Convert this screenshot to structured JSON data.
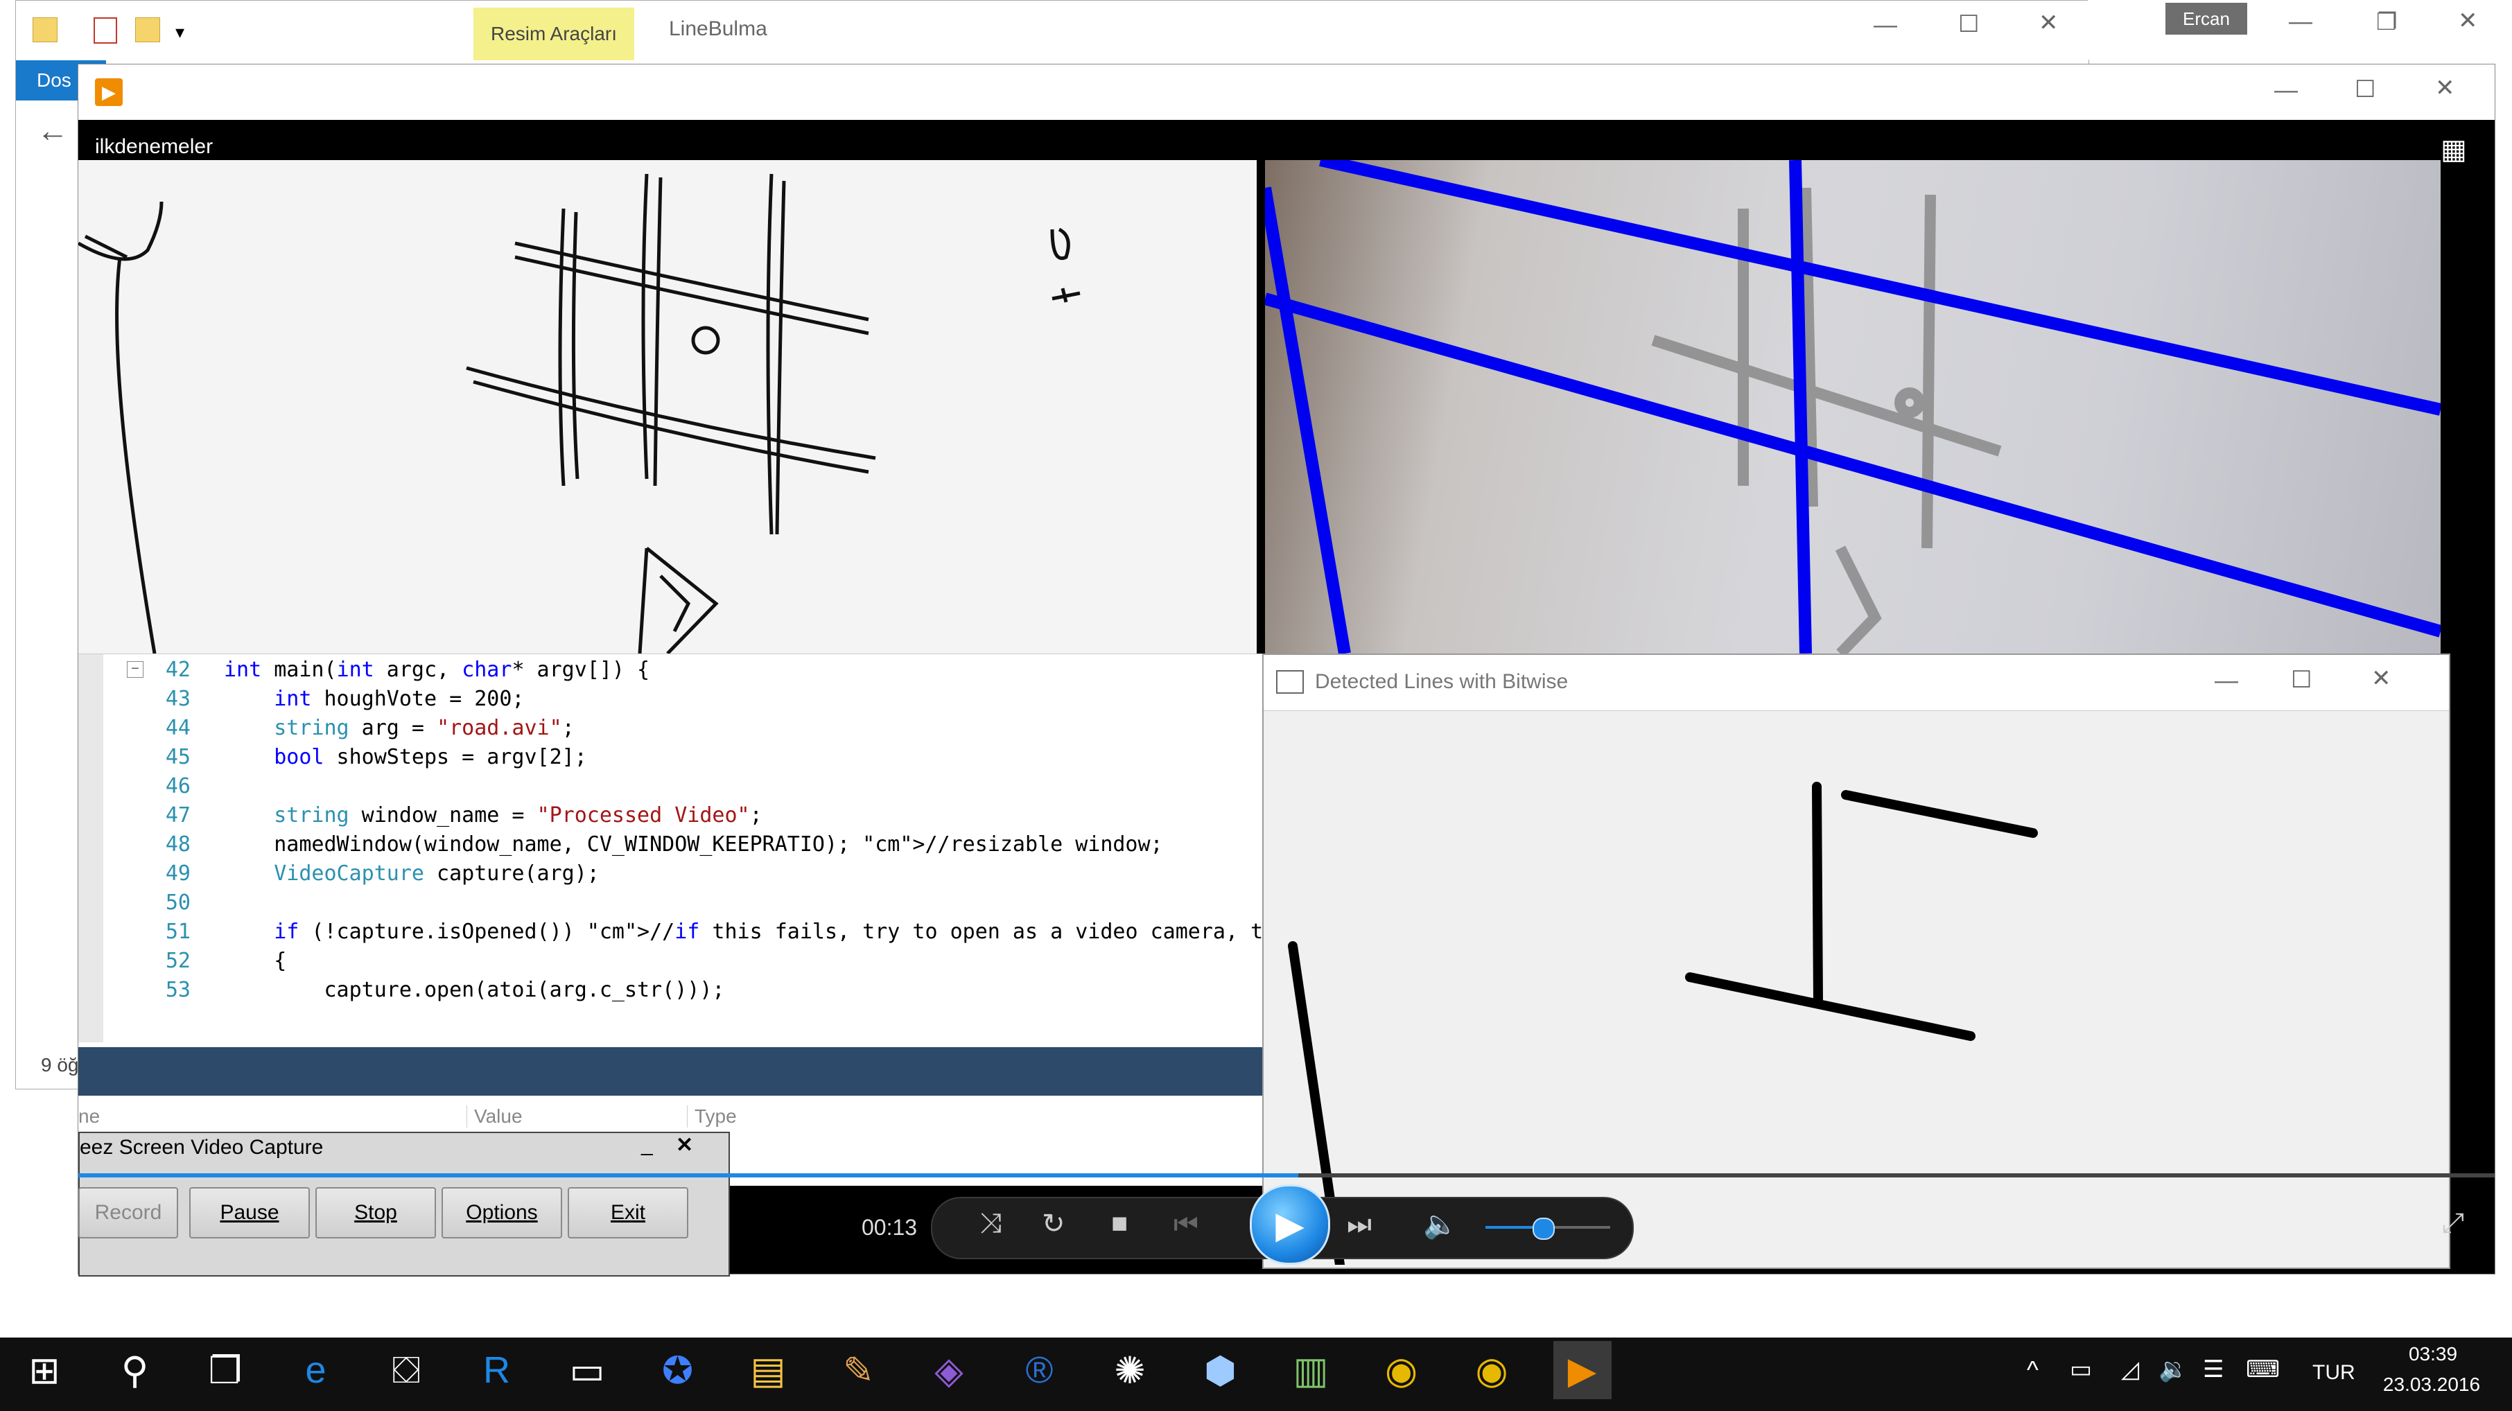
{
  "explorer": {
    "ribbon_tab_highlight": "Resim Araçları",
    "title": "LineBulma",
    "file_tab": "Dos",
    "status_items": "9 öğ",
    "accent": "#1979ca"
  },
  "background_window": {
    "user_badge": "Ercan"
  },
  "player": {
    "time": "00:13",
    "accent": "#1e88e5"
  },
  "ilk": {
    "title": "ilkdenemeler"
  },
  "detected": {
    "title": "Detected Lines with Bitwise"
  },
  "code": {
    "lines": [
      {
        "n": "42",
        "text": "int main(int argc, char* argv[]) {"
      },
      {
        "n": "43",
        "text": "    int houghVote = 200;"
      },
      {
        "n": "44",
        "text": "    string arg = \"road.avi\";"
      },
      {
        "n": "45",
        "text": "    bool showSteps = argv[2];"
      },
      {
        "n": "46",
        "text": ""
      },
      {
        "n": "47",
        "text": "    string window_name = \"Processed Video\";"
      },
      {
        "n": "48",
        "text": "    namedWindow(window_name, CV_WINDOW_KEEPRATIO); //resizable window;"
      },
      {
        "n": "49",
        "text": "    VideoCapture capture(arg);"
      },
      {
        "n": "50",
        "text": ""
      },
      {
        "n": "51",
        "text": "    if (!capture.isOpened()) //if this fails, try to open as a video camera, through th"
      },
      {
        "n": "52",
        "text": "    {"
      },
      {
        "n": "53",
        "text": "        capture.open(atoi(arg.c_str()));"
      }
    ]
  },
  "watch_panel": {
    "col_name": "ne",
    "col_value": "Value",
    "col_type": "Type"
  },
  "capture_tool": {
    "title": "eez Screen Video Capture",
    "buttons": {
      "record": "Record",
      "pause": "Pause",
      "stop": "Stop",
      "options": "Options",
      "exit": "Exit"
    }
  },
  "taskbar": {
    "language": "TUR",
    "time": "03:39",
    "date": "23.03.2016",
    "bg": "#101010",
    "icons": [
      "start-icon",
      "search-icon",
      "task-view-icon",
      "edge-icon",
      "store-icon",
      "r-studio-icon",
      "terminal-icon",
      "vpn-icon",
      "file-explorer-icon",
      "paint-icon",
      "visual-studio-icon",
      "r-icon",
      "app-icon",
      "box-icon",
      "notepad-icon",
      "chrome-icon",
      "chrome-icon-2",
      "media-player-icon"
    ]
  }
}
